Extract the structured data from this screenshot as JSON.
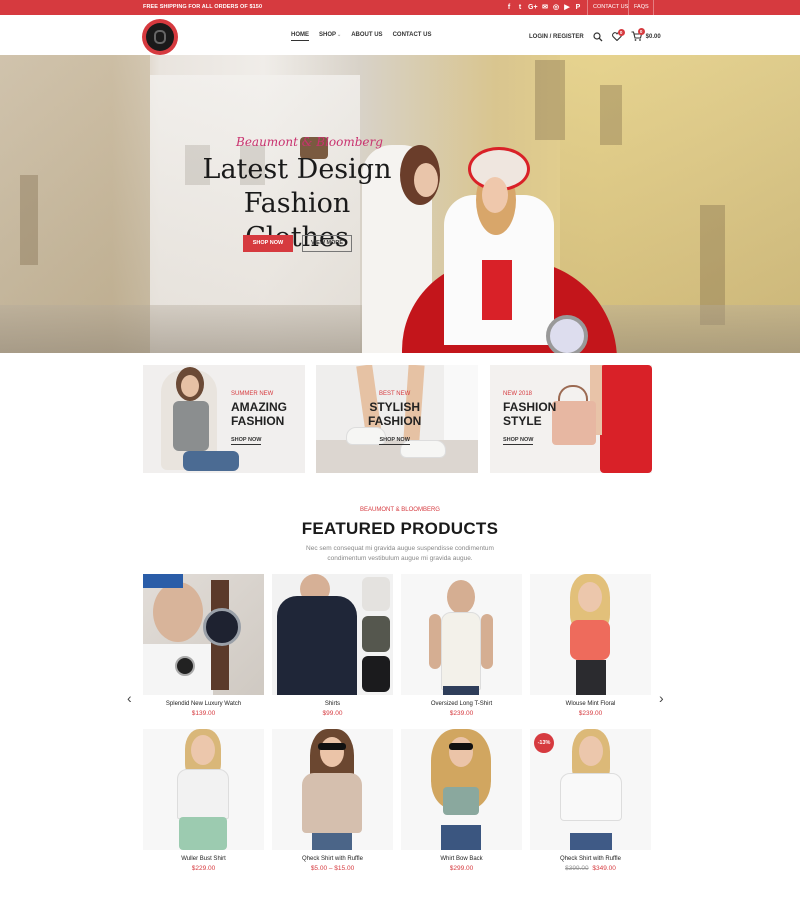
{
  "topbar": {
    "shipping_text": "FREE SHIPPING FOR ALL ORDERS OF $150",
    "social_icons": [
      "facebook-icon",
      "twitter-icon",
      "google-plus-icon",
      "email-icon",
      "instagram-icon",
      "youtube-icon",
      "pinterest-icon"
    ],
    "social_glyphs": [
      "f",
      "t",
      "G+",
      "✉",
      "◎",
      "▶",
      "P"
    ],
    "contact_label": "CONTACT US",
    "faqs_label": "FAQS"
  },
  "header": {
    "nav": [
      {
        "label": "HOME",
        "active": true
      },
      {
        "label": "SHOP",
        "dropdown": true
      },
      {
        "label": "ABOUT US"
      },
      {
        "label": "CONTACT US"
      }
    ],
    "login_label": "LOGIN / REGISTER",
    "wishlist_count": "0",
    "cart_count": "0",
    "cart_total": "$0.00"
  },
  "hero": {
    "subtitle": "Beaumont & Bloomberg",
    "title_line1": "Latest Design",
    "title_line2": "Fashion Clothes",
    "shop_now": "SHOP NOW",
    "view_more": "VIEW MORE"
  },
  "promos": [
    {
      "pre": "SUMMER NEW",
      "line1": "AMAZING",
      "line2": "FASHION",
      "link": "SHOP NOW"
    },
    {
      "pre": "BEST NEW",
      "line1": "STYLISH",
      "line2": "FASHION",
      "link": "SHOP NOW"
    },
    {
      "pre": "NEW 2018",
      "line1": "FASHION",
      "line2": "STYLE",
      "link": "SHOP NOW"
    }
  ],
  "featured": {
    "pre": "BEAUMONT & BLOOMBERG",
    "title": "FEATURED PRODUCTS",
    "description": "Nec sem consequat mi gravida augue suspendisse condimentum condimentum vestibulum augue mi gravida augue.",
    "products": [
      {
        "name": "Splendid New Luxury Watch",
        "price": "$139.00"
      },
      {
        "name": "Shirts",
        "price": "$99.00"
      },
      {
        "name": "Oversized Long T-Shirt",
        "price": "$239.00"
      },
      {
        "name": "Wlouse Mint Floral",
        "price": "$239.00"
      },
      {
        "name": "Wuller Bust Shirt",
        "price": "$229.00"
      },
      {
        "name": "Qheck Shirt with Ruffle",
        "price": "$5.00 – $15.00"
      },
      {
        "name": "Whirt Bow Back",
        "price": "$299.00"
      },
      {
        "name": "Qheck Shirt with Ruffle",
        "old_price": "$399.00",
        "price": "$349.00",
        "sale_badge": "-13%"
      }
    ]
  },
  "colors": {
    "accent": "#d63a3f",
    "text": "#1a1a1a"
  }
}
